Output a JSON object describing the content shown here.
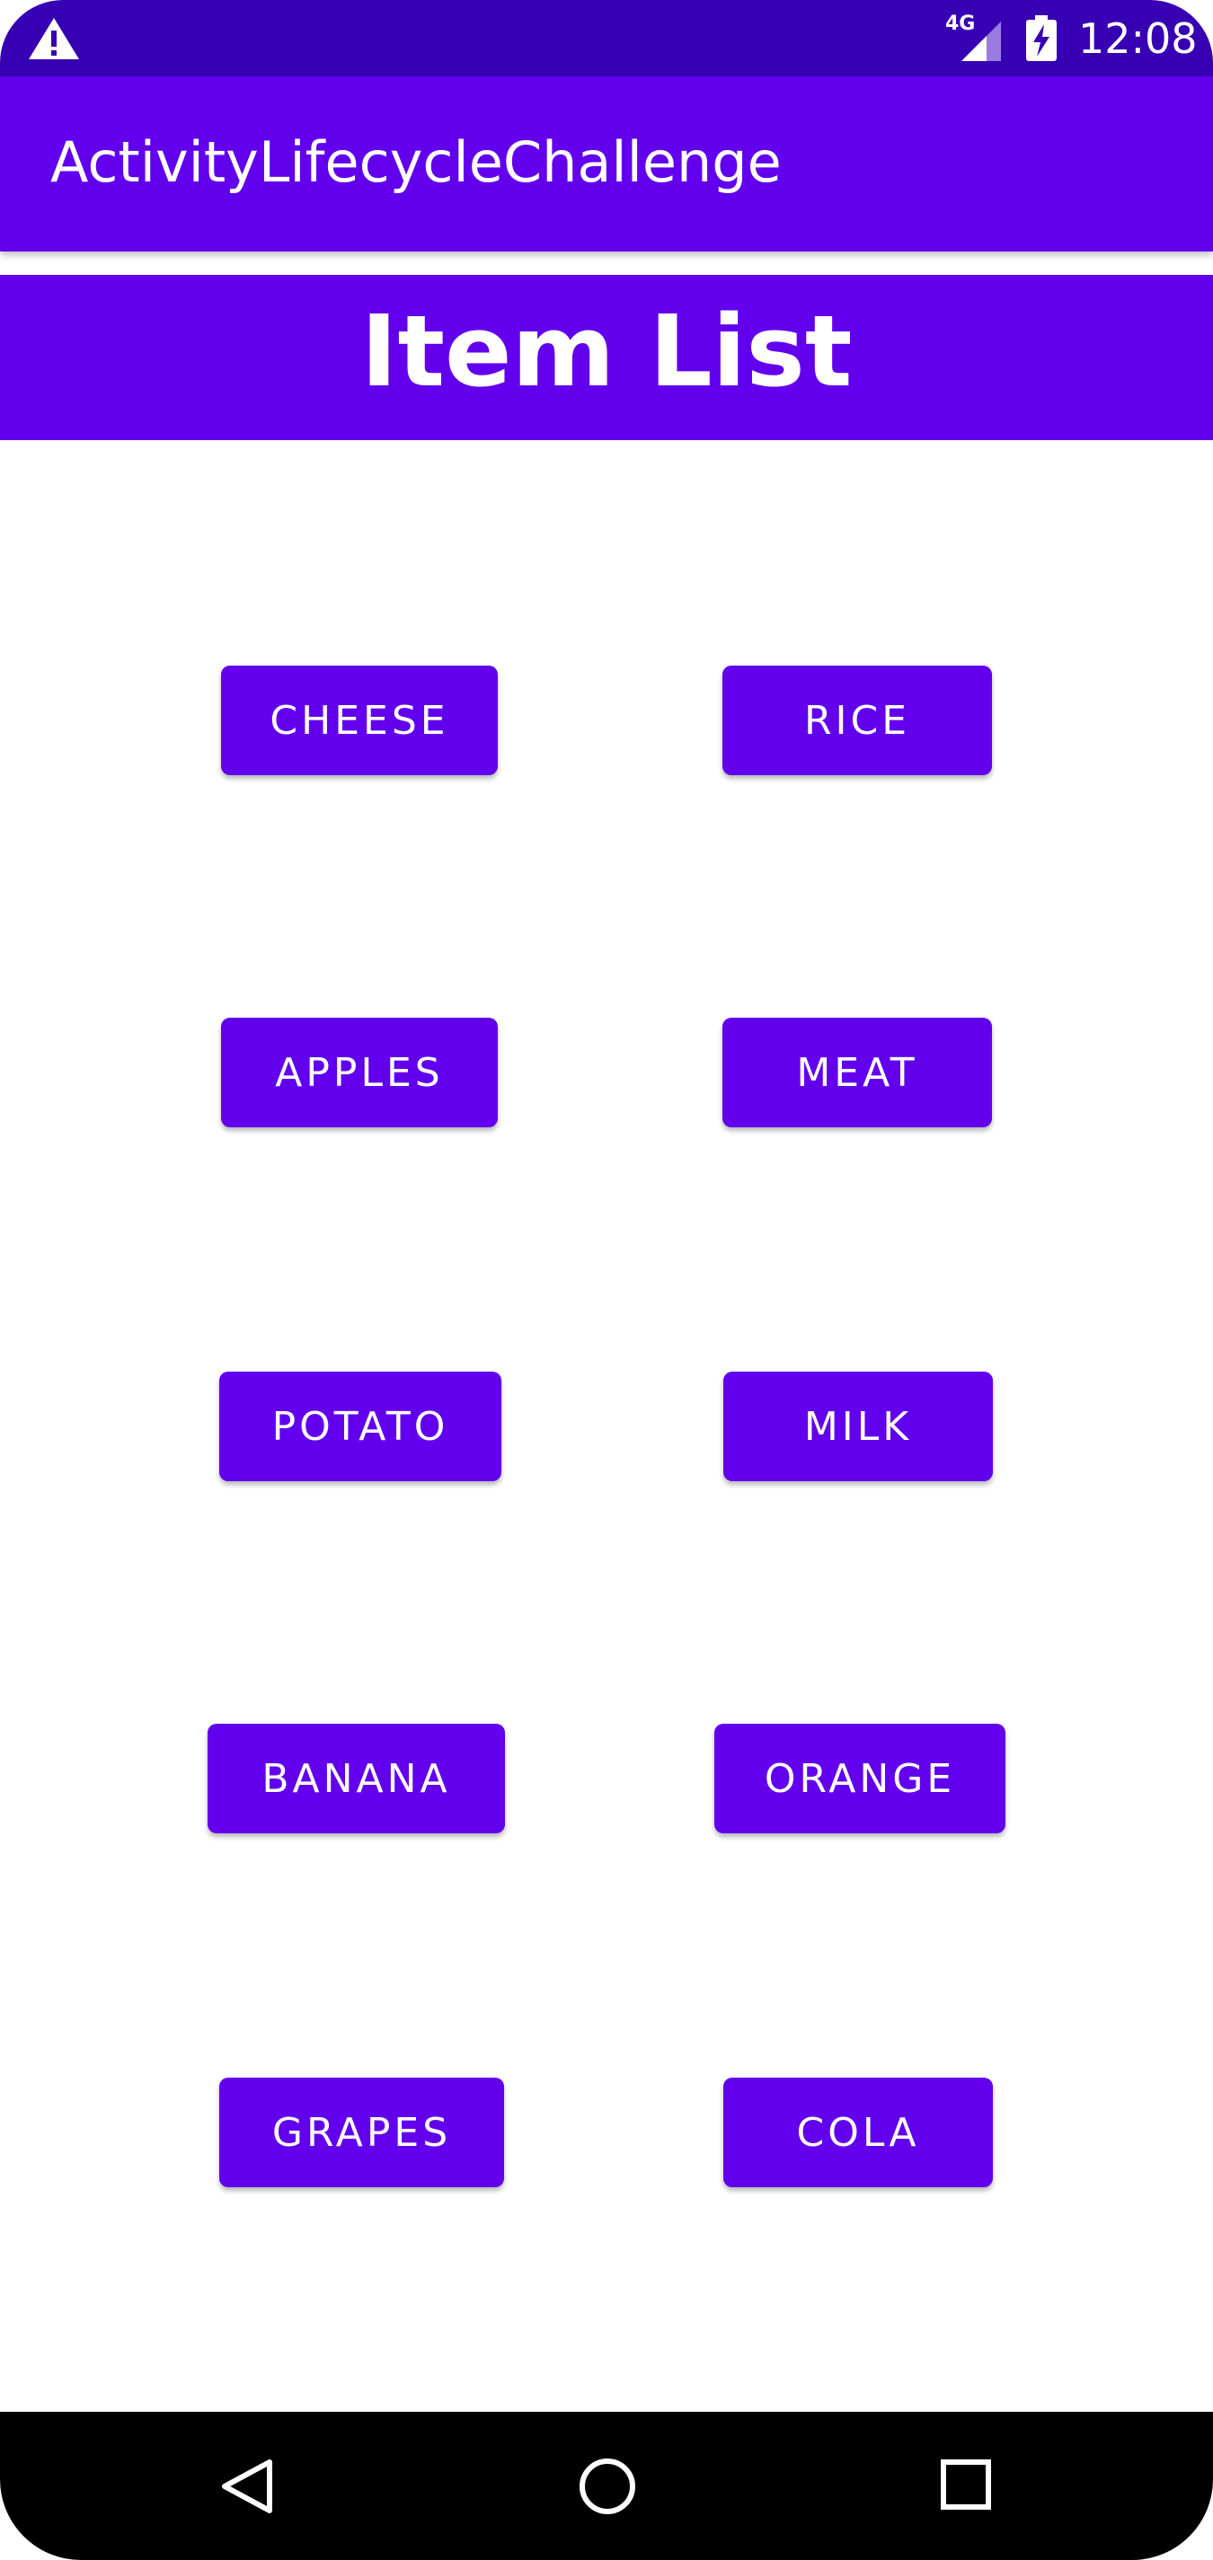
{
  "status_bar": {
    "network": "4G",
    "time": "12:08",
    "icons": [
      "warning-icon",
      "cell-signal-icon",
      "battery-charging-icon"
    ]
  },
  "app_bar": {
    "title": "ActivityLifecycleChallenge"
  },
  "header": {
    "title": "Item List"
  },
  "items": [
    "CHEESE",
    "RICE",
    "APPLES",
    "MEAT",
    "POTATO",
    "MILK",
    "BANANA",
    "ORANGE",
    "GRAPES",
    "COLA"
  ],
  "nav_bar": {
    "icons": [
      "back-icon",
      "home-icon",
      "recents-icon"
    ]
  },
  "colors": {
    "primary": "#6200EE",
    "primary_dark": "#3700B3",
    "on_primary": "#FFFFFF"
  }
}
